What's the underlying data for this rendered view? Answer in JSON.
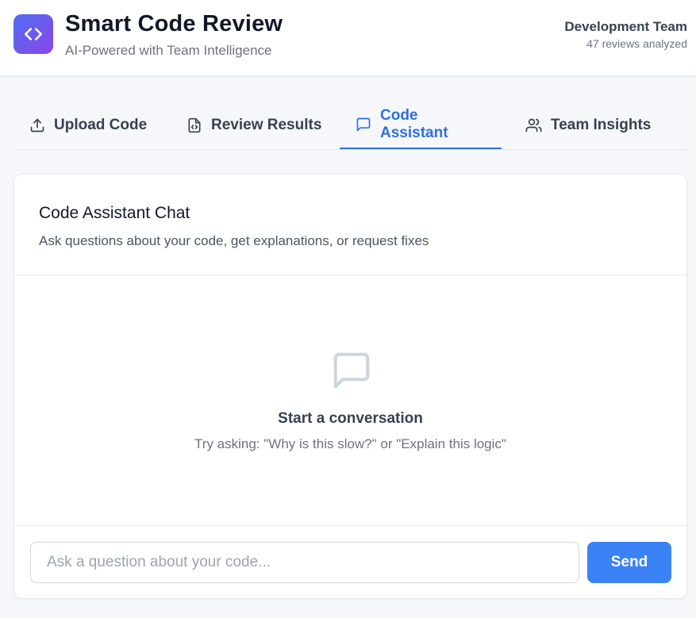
{
  "app": {
    "title": "Smart Code Review",
    "subtitle": "AI-Powered with Team Intelligence",
    "logo_icon": "code-brackets-icon"
  },
  "team": {
    "name": "Development Team",
    "meta": "47 reviews analyzed"
  },
  "tabs": [
    {
      "label": "Upload Code",
      "icon": "upload-icon",
      "active": false
    },
    {
      "label": "Review Results",
      "icon": "file-code-icon",
      "active": false
    },
    {
      "label": "Code Assistant",
      "icon": "chat-bubble-icon",
      "active": true
    },
    {
      "label": "Team Insights",
      "icon": "users-icon",
      "active": false
    }
  ],
  "chat": {
    "title": "Code Assistant Chat",
    "description": "Ask questions about your code, get explanations, or request fixes",
    "empty_state": {
      "icon": "chat-bubble-icon",
      "title": "Start a conversation",
      "hint": "Try asking: \"Why is this slow?\" or \"Explain this logic\""
    },
    "input": {
      "value": "",
      "placeholder": "Ask a question about your code..."
    },
    "send_label": "Send"
  },
  "colors": {
    "accent": "#2f6fe0",
    "send_button": "#3b82f6",
    "logo_gradient_start": "#4f6ff0",
    "logo_gradient_end": "#8b45e8",
    "page_background": "#f5f7fa"
  }
}
